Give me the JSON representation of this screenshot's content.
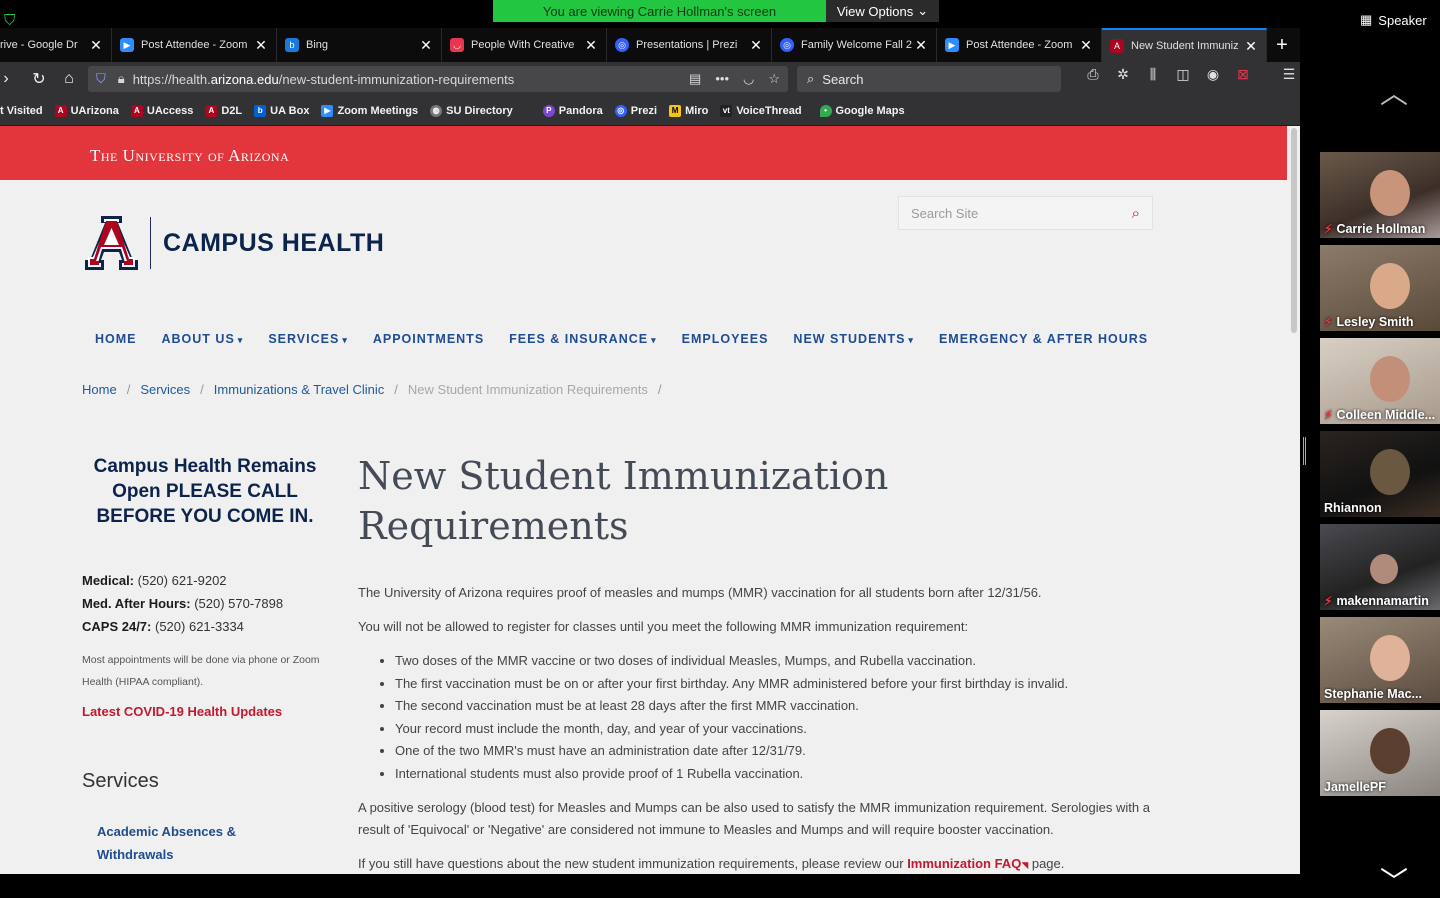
{
  "zoom": {
    "viewing_banner": "You are viewing Carrie Hollman's screen",
    "view_options": "View Options",
    "speaker_view": "Speaker",
    "participants": [
      {
        "name": "Carrie Hollman",
        "muted": true
      },
      {
        "name": "Lesley Smith",
        "muted": true
      },
      {
        "name": "Colleen Middle...",
        "muted": true
      },
      {
        "name": "Rhiannon",
        "muted": false
      },
      {
        "name": "makennamartin",
        "muted": true
      },
      {
        "name": "Stephanie Mac...",
        "muted": false
      },
      {
        "name": "JamellePF",
        "muted": false
      }
    ]
  },
  "browser": {
    "tabs": [
      {
        "title": "rive - Google Dr",
        "color": "#2f6fd6"
      },
      {
        "title": "Post Attendee - Zoom",
        "color": "#2d8cff"
      },
      {
        "title": "Bing",
        "color": "#1a7ad9"
      },
      {
        "title": "People With Creative",
        "color": "#e8364f"
      },
      {
        "title": "Presentations | Prezi",
        "color": "#3360ff"
      },
      {
        "title": "Family Welcome Fall 2",
        "color": "#3360ff"
      },
      {
        "title": "Post Attendee - Zoom",
        "color": "#2d8cff"
      },
      {
        "title": "New Student Immuniz",
        "color": "#ab0520"
      }
    ],
    "url_prefix": "https://health.",
    "url_host": "arizona.edu",
    "url_path": "/new-student-immunization-requirements",
    "search_placeholder": "Search",
    "bookmarks": [
      {
        "label": "t Visited",
        "color": ""
      },
      {
        "label": "UArizona",
        "color": "#ab0520"
      },
      {
        "label": "UAccess",
        "color": "#ab0520"
      },
      {
        "label": "D2L",
        "color": "#ab0520"
      },
      {
        "label": "UA Box",
        "color": "#0061d5"
      },
      {
        "label": "Zoom Meetings",
        "color": "#2d8cff"
      },
      {
        "label": "SU Directory",
        "color": "#777777"
      },
      {
        "label": "Pandora",
        "color": "#7b46d6"
      },
      {
        "label": "Prezi",
        "color": "#3360ff"
      },
      {
        "label": "Miro",
        "color": "#f5c518"
      },
      {
        "label": "VoiceThread",
        "color": "#222222"
      },
      {
        "label": "Google Maps",
        "color": "#34a853"
      }
    ]
  },
  "site": {
    "university": "The University of Arizona",
    "logo_text": "CAMPUS HEALTH",
    "search_placeholder": "Search Site",
    "nav": [
      {
        "label": "HOME",
        "dropdown": false
      },
      {
        "label": "ABOUT US",
        "dropdown": true
      },
      {
        "label": "SERVICES",
        "dropdown": true
      },
      {
        "label": "APPOINTMENTS",
        "dropdown": false
      },
      {
        "label": "FEES & INSURANCE",
        "dropdown": true
      },
      {
        "label": "EMPLOYEES",
        "dropdown": false
      },
      {
        "label": "NEW STUDENTS",
        "dropdown": true
      },
      {
        "label": "EMERGENCY & AFTER HOURS",
        "dropdown": false
      }
    ],
    "breadcrumbs": [
      "Home",
      "Services",
      "Immunizations & Travel Clinic"
    ],
    "breadcrumb_current": "New Student Immunization Requirements",
    "sidebar": {
      "notice": "Campus Health Remains Open PLEASE CALL BEFORE YOU COME IN.",
      "contacts": [
        {
          "label": "Medical:",
          "value": "(520) 621-9202"
        },
        {
          "label": "Med. After Hours:",
          "value": "(520) 570-7898"
        },
        {
          "label": "CAPS 24/7:",
          "value": "(520) 621-3334"
        }
      ],
      "note": "Most appointments will be done via phone or Zoom Health (HIPAA compliant).",
      "covid_link": "Latest COVID-19 Health Updates",
      "services_heading": "Services",
      "service_link": "Academic Absences & Withdrawals"
    },
    "title": "New Student Immunization Requirements",
    "para1": "The University of Arizona requires proof of measles and mumps (MMR) vaccination for all students born after 12/31/56.",
    "para2": "You will not be allowed to register for classes until you meet the following MMR immunization requirement:",
    "requirements": [
      "Two doses of the MMR vaccine or two doses of individual Measles, Mumps, and Rubella vaccination.",
      "The first vaccination must be on or after your first birthday. Any MMR administered before your first birthday is invalid.",
      "The second vaccination must be at least 28 days after the first MMR vaccination.",
      "Your record must include the month, day, and year of your vaccinations.",
      "One of the two MMR's must have an administration date after 12/31/79.",
      "International students must also provide proof of 1 Rubella vaccination."
    ],
    "para3": "A positive serology (blood test) for Measles and Mumps can be also used to satisfy the MMR immunization requirement. Serologies with a result of 'Equivocal' or 'Negative' are considered not immune to Measles and Mumps and will require booster vaccination.",
    "para4_pre": "If you still have questions about the new student immunization requirements, please review our ",
    "para4_link": "Immunization FAQ",
    "para4_post": " page."
  }
}
